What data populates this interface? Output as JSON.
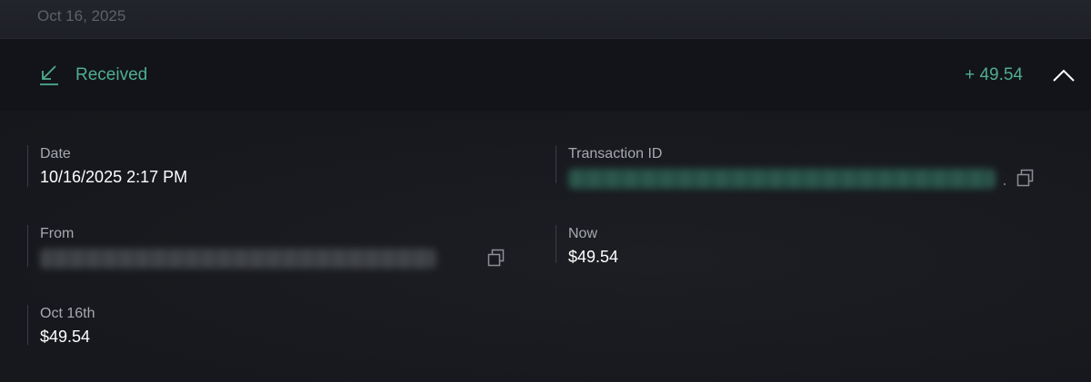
{
  "date_header": "Oct 16, 2025",
  "transaction": {
    "type_label": "Received",
    "amount": "+ 49.54",
    "icon": "arrow-down-left-icon",
    "accent_color": "#4fae8e"
  },
  "details": {
    "date_label": "Date",
    "date_value": "10/16/2025 2:17 PM",
    "txid_label": "Transaction ID",
    "from_label": "From",
    "now_label": "Now",
    "now_value": "$49.54",
    "historic_label": "Oct 16th",
    "historic_value": "$49.54"
  }
}
